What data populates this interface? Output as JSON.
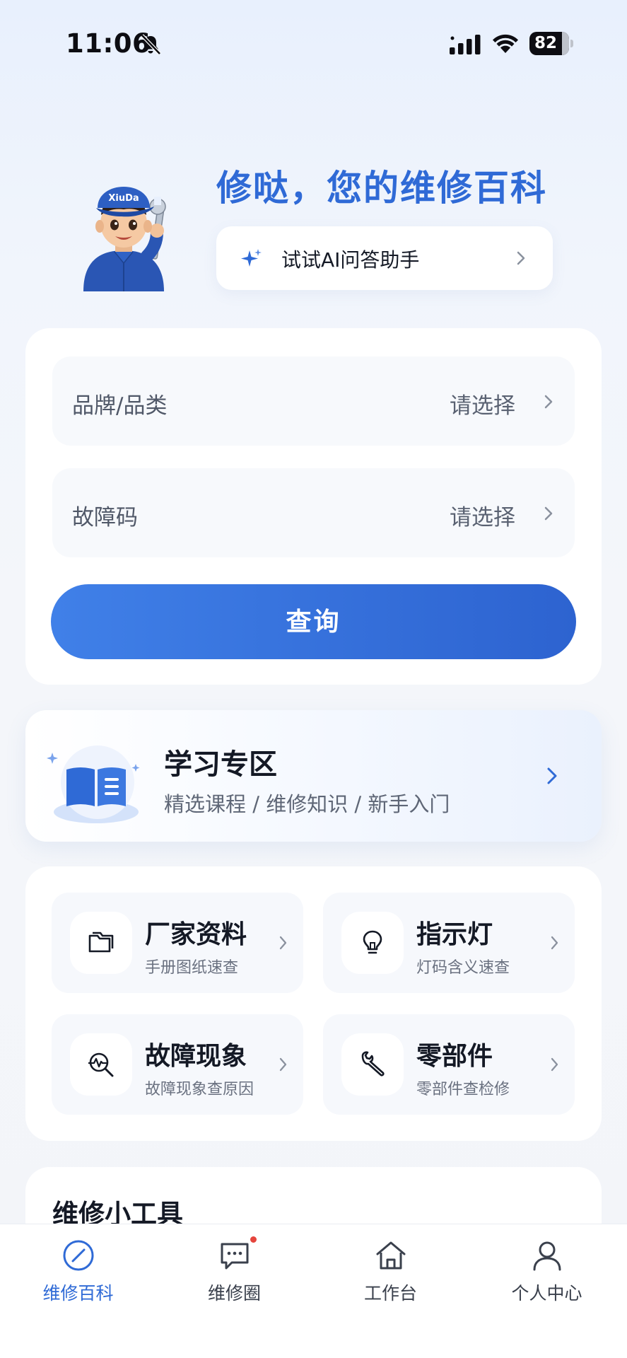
{
  "status_bar": {
    "time": "11:06",
    "battery_level": "82"
  },
  "hero": {
    "title": "修哒，您的维修百科",
    "mascot_cap_text": "XiuDa",
    "ai_assistant_label": "试试AI问答助手"
  },
  "query": {
    "brand_label": "品牌/品类",
    "brand_value": "请选择",
    "fault_code_label": "故障码",
    "fault_code_value": "请选择",
    "button_label": "查询"
  },
  "learning": {
    "title": "学习专区",
    "subtitle": "精选课程 / 维修知识 / 新手入门"
  },
  "features": [
    {
      "title": "厂家资料",
      "desc": "手册图纸速查",
      "icon": "folder-icon"
    },
    {
      "title": "指示灯",
      "desc": "灯码含义速查",
      "icon": "lightbulb-icon"
    },
    {
      "title": "故障现象",
      "desc": "故障现象查原因",
      "icon": "diagnose-search-icon"
    },
    {
      "title": "零部件",
      "desc": "零部件查检修",
      "icon": "wrench-icon"
    }
  ],
  "tools": {
    "title": "维修小工具"
  },
  "tab_bar": {
    "items": [
      {
        "label": "维修百科",
        "icon": "compass-icon",
        "active": true
      },
      {
        "label": "维修圈",
        "icon": "chat-icon",
        "badge": true
      },
      {
        "label": "工作台",
        "icon": "home-icon"
      },
      {
        "label": "个人中心",
        "icon": "user-icon"
      }
    ]
  },
  "colors": {
    "brand_blue": "#2f6ad6",
    "button_gradient_start": "#4080e8",
    "button_gradient_end": "#2d63d0",
    "badge_red": "#e5453d"
  }
}
